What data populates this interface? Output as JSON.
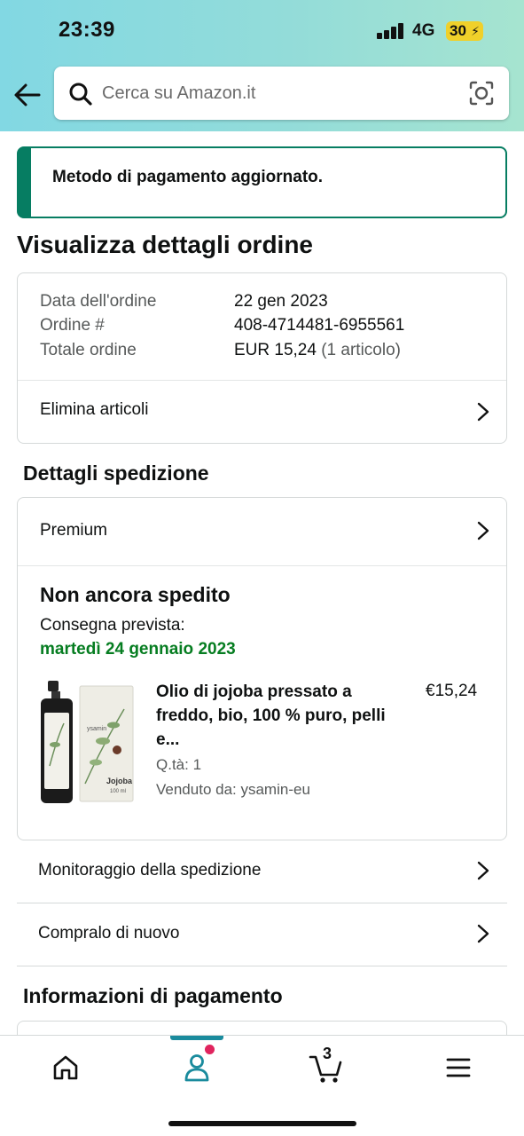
{
  "status_bar": {
    "time": "23:39",
    "network": "4G",
    "battery": "30"
  },
  "search": {
    "placeholder": "Cerca su Amazon.it"
  },
  "alert": {
    "message": "Metodo di pagamento aggiornato."
  },
  "page_title": "Visualizza dettagli ordine",
  "order_info": {
    "rows": [
      {
        "label": "Data dell'ordine",
        "value": "22 gen 2023"
      },
      {
        "label": "Ordine #",
        "value": "408-4714481-6955561"
      },
      {
        "label": "Totale ordine",
        "value": "EUR 15,24",
        "extra": "(1 articolo)"
      }
    ],
    "delete_items": "Elimina articoli"
  },
  "shipping": {
    "title": "Dettagli spedizione",
    "method": "Premium",
    "status": "Non ancora spedito",
    "delivery_label": "Consegna prevista:",
    "delivery_date": "martedì 24 gennaio 2023",
    "product": {
      "name": "Olio di jojoba pressato a freddo, bio, 100 % puro, pelli e...",
      "price": "€15,24",
      "qty": "Q.tà: 1",
      "seller": "Venduto da: ysamin-eu",
      "label_brand": "ysamin",
      "label_product": "Jojoba",
      "label_volume": "100 ml"
    },
    "track": "Monitoraggio della spedizione",
    "buy_again": "Compralo di nuovo"
  },
  "payment": {
    "title": "Informazioni di pagamento"
  },
  "tabbar": {
    "cart_count": "3"
  },
  "colors": {
    "accent_teal": "#1a8b9d",
    "success_green": "#067d62",
    "delivery_green": "#067d21",
    "notif": "#e0245e"
  }
}
